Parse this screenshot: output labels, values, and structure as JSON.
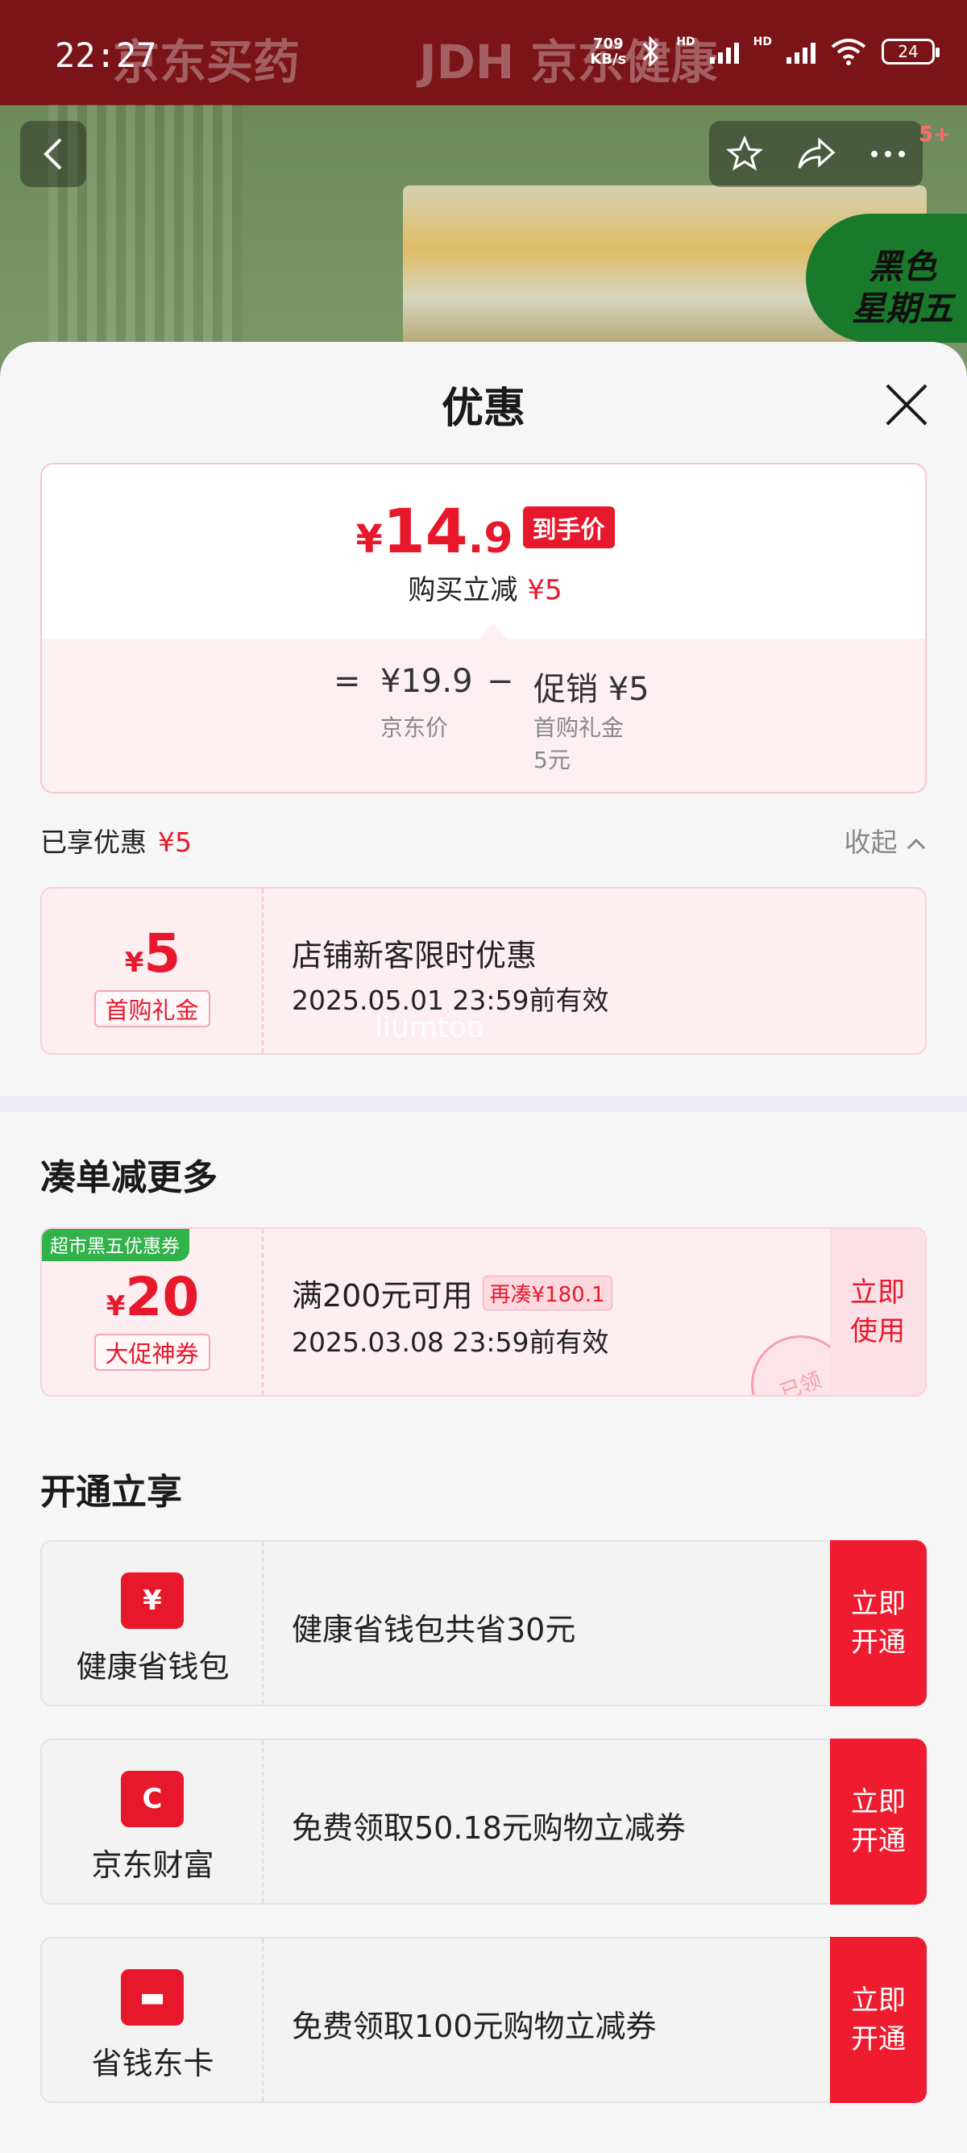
{
  "status": {
    "time": "22:27",
    "net_speed_value": "709",
    "net_speed_unit": "KB/s",
    "hd1": "HD",
    "hd2": "HD",
    "wifi_num": "6",
    "battery": "24"
  },
  "header": {
    "brand_left": "京东买药",
    "brand_right": "JDH 京东健康",
    "promo_badge_line1": "黑色",
    "promo_badge_line2": "星期五",
    "message_count": "5+"
  },
  "sheet": {
    "title": "优惠"
  },
  "price_card": {
    "currency": "¥",
    "final_int": "14",
    "final_dec": ".9",
    "final_tag": "到手价",
    "reduce_label": "购买立减",
    "reduce_value": "¥5",
    "equals": "=",
    "jd_price": "¥19.9",
    "jd_price_label": "京东价",
    "minus": "−",
    "promo_label": "促销 ¥5",
    "promo_sub1": "首购礼金",
    "promo_sub2": "5元"
  },
  "enjoyed": {
    "label": "已享优惠",
    "value": "¥5",
    "collapse": "收起"
  },
  "coupon_new": {
    "currency": "¥",
    "amount": "5",
    "tag": "首购礼金",
    "title": "店铺新客限时优惠",
    "validity": "2025.05.01 23:59前有效"
  },
  "watermark": "liumtoo",
  "more_section": {
    "title": "凑单减更多"
  },
  "coupon_big": {
    "badge": "超市黑五优惠券",
    "currency": "¥",
    "amount": "20",
    "tag": "大促神券",
    "title": "满200元可用",
    "extra": "再凑¥180.1",
    "validity": "2025.03.08 23:59前有效",
    "button_line1": "立即",
    "button_line2": "使用",
    "stamp": "已领"
  },
  "open_section": {
    "title": "开通立享"
  },
  "services": [
    {
      "name": "健康省钱包",
      "icon": "¥",
      "desc": "健康省钱包共省30元",
      "btn1": "立即",
      "btn2": "开通"
    },
    {
      "name": "京东财富",
      "icon": "C",
      "desc": "免费领取50.18元购物立减券",
      "btn1": "立即",
      "btn2": "开通"
    },
    {
      "name": "省钱东卡",
      "icon": "▬",
      "desc": "免费领取100元购物立减券",
      "btn1": "立即",
      "btn2": "开通"
    }
  ],
  "colors": {
    "accent": "#e8182c",
    "promo_green": "#32b24a"
  }
}
